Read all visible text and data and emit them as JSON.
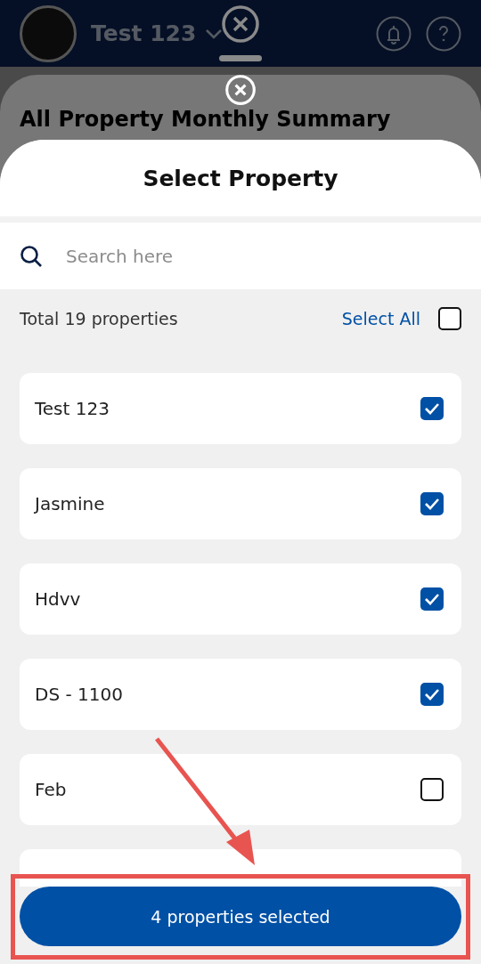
{
  "header": {
    "property_name": "Test 123"
  },
  "back_sheet": {
    "title": "All Property Monthly Summary"
  },
  "sheet": {
    "title": "Select Property",
    "search": {
      "placeholder": "Search here"
    },
    "total": "Total 19 properties",
    "select_all": {
      "label": "Select All",
      "checked": false
    },
    "properties": [
      {
        "name": "Test 123",
        "checked": true
      },
      {
        "name": "Jasmine",
        "checked": true
      },
      {
        "name": "Hdvv",
        "checked": true
      },
      {
        "name": "DS - 1100",
        "checked": true
      },
      {
        "name": "Feb",
        "checked": false
      }
    ],
    "confirm_button": "4 properties selected"
  }
}
